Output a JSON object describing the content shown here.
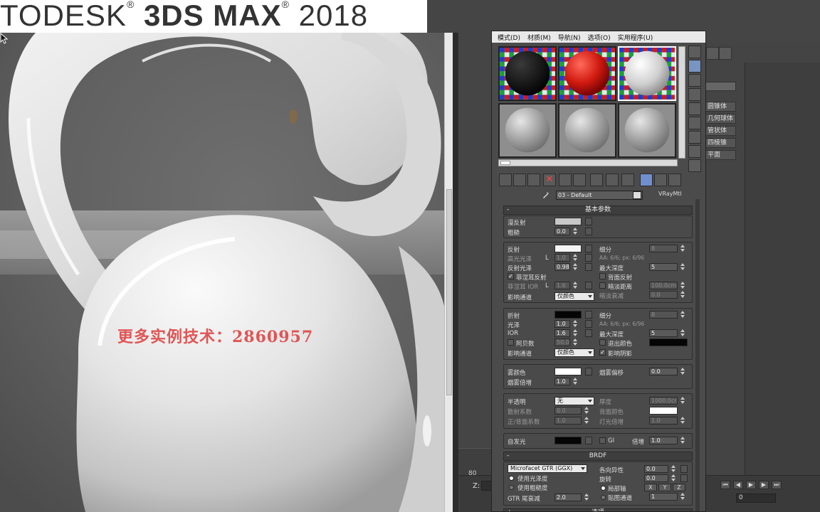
{
  "app": {
    "title_pre": "TODESK",
    "title_product": "3DS MAX",
    "title_year": "2018",
    "registered_mark": "®"
  },
  "viewport": {
    "watermark": "更多实例技术：2860957"
  },
  "material_editor": {
    "menu": [
      "模式(D)",
      "材质(M)",
      "导航(N)",
      "选项(O)",
      "实用程序(U)"
    ],
    "material_name": "03 - Default",
    "material_type": "VRayMtl",
    "rollouts": {
      "basic": "基本参数",
      "brdf": "BRDF",
      "next": "选项"
    },
    "diffuse": {
      "diffuse_label": "漫反射",
      "roughness_label": "粗糙",
      "roughness_value": "0.0",
      "diffuse_color": "#c8c8c8"
    },
    "reflection": {
      "reflect_label": "反射",
      "reflect_color": "#f4f4f4",
      "hilight_label": "高光光泽",
      "hilight_lock": "L",
      "hilight_value": "1.0",
      "gloss_label": "反射光泽",
      "gloss_value": "0.98",
      "fresnel_label": "菲涅耳反射",
      "fresnel_ior_label": "菲涅耳 IOR",
      "fresnel_ior_lock": "L",
      "fresnel_ior_value": "1.6",
      "affect_label": "影响通道",
      "affect_value": "仅颜色",
      "subdiv_label": "细分",
      "subdiv_value": "8",
      "aa_text": "AA: 6/6; px: 6/96",
      "maxdepth_label": "最大深度",
      "maxdepth_value": "5",
      "backside_label": "背面反射",
      "dim_label": "暗淡距离",
      "dim_value": "100.0cm",
      "dimfall_label": "暗淡衰减",
      "dimfall_value": "0.0"
    },
    "refraction": {
      "refract_label": "折射",
      "refract_color": "#050505",
      "gloss_label": "光泽",
      "gloss_value": "1.0",
      "ior_label": "IOR",
      "ior_value": "1.6",
      "abbe_label": "阿贝数",
      "abbe_value": "50.0",
      "affect_label": "影响通道",
      "affect_value": "仅颜色",
      "subdiv_label": "细分",
      "subdiv_value": "8",
      "aa_text": "AA: 6/6; px: 6/96",
      "maxdepth_label": "最大深度",
      "maxdepth_value": "5",
      "exit_label": "退出颜色",
      "exit_color": "#050505",
      "shadows_label": "影响阴影"
    },
    "fog": {
      "color_label": "雾颜色",
      "fog_color": "#ffffff",
      "mult_label": "烟雾倍增",
      "mult_value": "1.0",
      "bias_label": "烟雾偏移",
      "bias_value": "0.0"
    },
    "translucency": {
      "label": "半透明",
      "value": "无",
      "scatter_label": "散射系数",
      "scatter_value": "0.0",
      "fb_label": "正/背面系数",
      "fb_value": "1.0",
      "thickness_label": "厚度",
      "thickness_value": "1000.0cm",
      "back_color_label": "背面颜色",
      "back_color": "#ffffff",
      "light_mult_label": "灯光倍增",
      "light_mult_value": "1.0"
    },
    "self_illum": {
      "label": "自发光",
      "color": "#050505",
      "gi_label": "GI",
      "mult_label": "倍增",
      "mult_value": "1.0"
    },
    "brdf": {
      "type": "Microfacet GTR (GGX)",
      "use_gloss_label": "使用光泽度",
      "use_rough_label": "使用粗糙度",
      "gtr_label": "GTR 尾衰减",
      "gtr_value": "2.0",
      "aniso_label": "各向异性",
      "aniso_value": "0.0",
      "rotation_label": "旋转",
      "rotation_value": "0.0",
      "local_axis_label": "局部轴",
      "axis_x": "X",
      "axis_y": "Y",
      "axis_z": "Z",
      "map_channel_label": "贴图通道",
      "map_channel_value": "1"
    }
  },
  "command_panel": {
    "items": [
      "圆锥体",
      "几何球体",
      "管状体",
      "四棱锥",
      "平面"
    ]
  },
  "timeline": {
    "frame_tick": "80",
    "coord_label": "Z:",
    "frame_value": "0"
  }
}
